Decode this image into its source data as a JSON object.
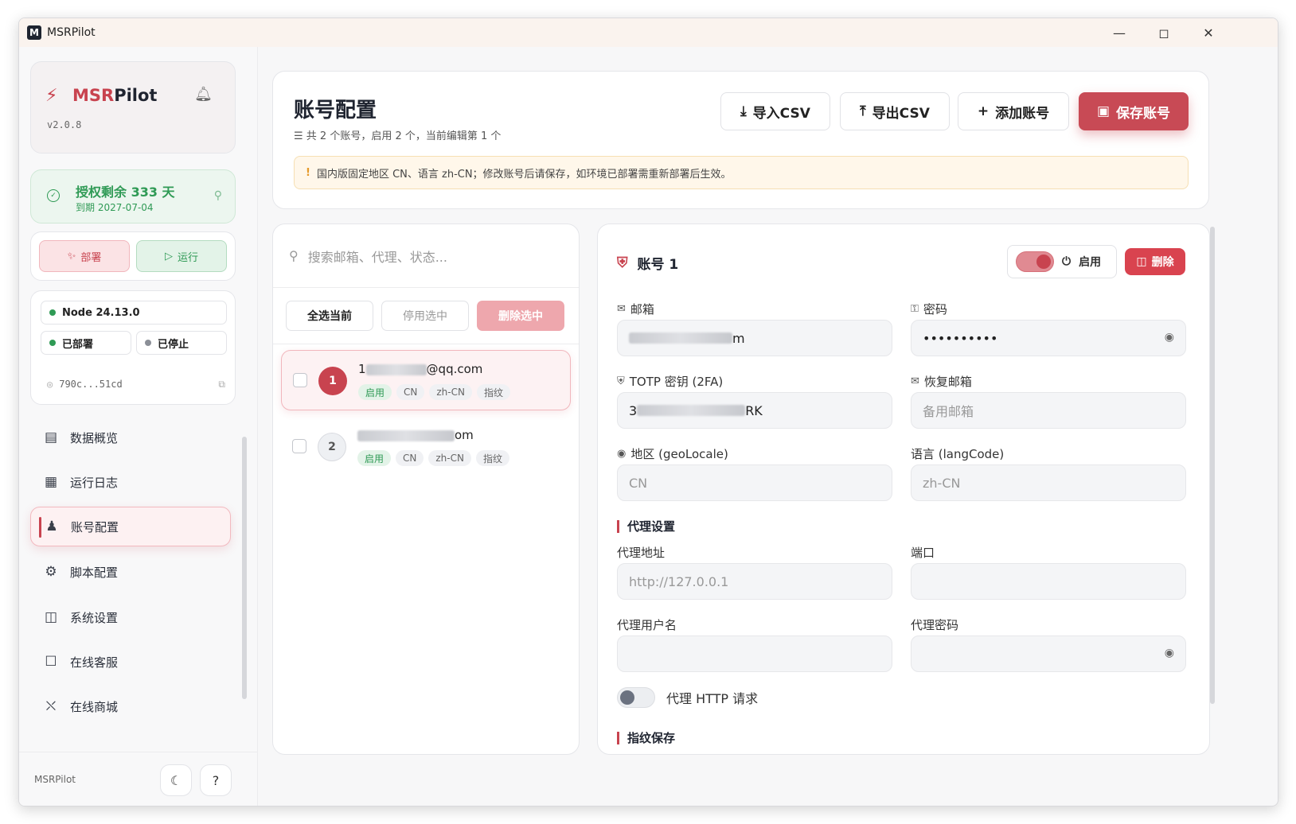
{
  "window": {
    "title": "MSRPilot",
    "logo": "M"
  },
  "sidebar": {
    "brand_prefix": "MSR",
    "brand_suffix": "Pilot",
    "version": "v2.0.8",
    "license_title": "授权剩余 333 天",
    "license_expiry": "到期 2027-07-04",
    "deploy_label": "部署",
    "run_label": "运行",
    "node_version": "Node 24.13.0",
    "deployed_label": "已部署",
    "stopped_label": "已停止",
    "hash": "790c...51cd",
    "nav": [
      {
        "label": "数据概览",
        "icon": "chart-icon"
      },
      {
        "label": "运行日志",
        "icon": "grid-icon"
      },
      {
        "label": "账号配置",
        "icon": "users-icon"
      },
      {
        "label": "脚本配置",
        "icon": "gear-icon"
      },
      {
        "label": "系统设置",
        "icon": "monitor-icon"
      },
      {
        "label": "在线客服",
        "icon": "chat-icon"
      },
      {
        "label": "在线商城",
        "icon": "cart-icon"
      }
    ],
    "footer_label": "MSRPilot"
  },
  "header": {
    "title": "账号配置",
    "subtitle": "共 2 个账号，启用 2 个，当前编辑第 1 个",
    "import_label": "导入CSV",
    "export_label": "导出CSV",
    "add_label": "添加账号",
    "save_label": "保存账号",
    "notice": "国内版固定地区 CN、语言 zh-CN；修改账号后请保存，如环境已部署需重新部署后生效。"
  },
  "account_list": {
    "search_placeholder": "搜索邮箱、代理、状态...",
    "select_all_label": "全选当前",
    "disable_selected_label": "停用选中",
    "delete_selected_label": "删除选中",
    "items": [
      {
        "index": "1",
        "email_visible_start": "1",
        "email_visible_end": "@qq.com",
        "tags": [
          "启用",
          "CN",
          "zh-CN",
          "指纹"
        ]
      },
      {
        "index": "2",
        "email_visible_start": "",
        "email_visible_end": "om",
        "tags": [
          "启用",
          "CN",
          "zh-CN",
          "指纹"
        ]
      }
    ]
  },
  "detail": {
    "title": "账号 1",
    "enabled_label": "启用",
    "delete_label": "删除",
    "email_label": "邮箱",
    "email_value_end": "m",
    "password_label": "密码",
    "password_value": "••••••••••",
    "totp_label": "TOTP 密钥 (2FA)",
    "totp_value_start": "3",
    "totp_value_end": "RK",
    "recovery_label": "恢复邮箱",
    "recovery_placeholder": "备用邮箱",
    "geo_label": "地区 (geoLocale)",
    "geo_value": "CN",
    "lang_label": "语言 (langCode)",
    "lang_value": "zh-CN",
    "proxy_section": "代理设置",
    "proxy_addr_label": "代理地址",
    "proxy_addr_placeholder": "http://127.0.0.1",
    "port_label": "端口",
    "proxy_user_label": "代理用户名",
    "proxy_pass_label": "代理密码",
    "proxy_http_label": "代理 HTTP 请求",
    "fingerprint_section": "指纹保存"
  },
  "colors": {
    "accent": "#c8434f",
    "success": "#2f9a55",
    "warning": "#e59a2a"
  }
}
